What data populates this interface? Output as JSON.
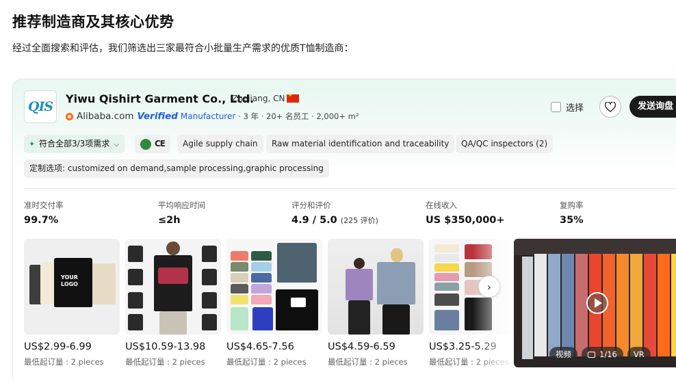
{
  "header": {
    "title": "推荐制造商及其核心优势",
    "subtitle": "经过全面搜索和评估，我们筛选出三家最符合小批量生产需求的优质T恤制造商："
  },
  "supplier": {
    "logo_text": "QIS",
    "name": "Yiwu Qishirt Garment Co., Ltd.",
    "location": "Zhejiang,  CN",
    "platform": "Alibaba.com",
    "verified": "Verified",
    "type": "Manufacturer",
    "meta": "· 3 年 · 20+ 名员工 · 2,000+ m²",
    "select_label": "选择",
    "inquiry_label": "发送询盘",
    "tags": {
      "match": "符合全部3/3项需求",
      "cert": "CE",
      "t1": "Agile supply chain",
      "t2": "Raw material identification and traceability",
      "t3": "QA/QC inspectors (2)",
      "custom": "定制选项: customized on demand,sample processing,graphic processing"
    },
    "stats": [
      {
        "label": "准时交付率",
        "value": "99.7%"
      },
      {
        "label": "平均响应时间",
        "value": "≤2h"
      },
      {
        "label": "评分和评价",
        "value": "4.9 / 5.0",
        "extra": "(225 评价)"
      },
      {
        "label": "在线收入",
        "value": "US $350,000+"
      },
      {
        "label": "复购率",
        "value": "35%"
      }
    ],
    "products": [
      {
        "price": "US$2.99-6.99",
        "moq": "最低起订量 : 2 pieces"
      },
      {
        "price": "US$10.59-13.98",
        "moq": "最低起订量 : 2 pieces"
      },
      {
        "price": "US$4.65-7.56",
        "moq": "最低起订量 : 2 pieces"
      },
      {
        "price": "US$4.59-6.59",
        "moq": "最低起订量 : 2 pieces"
      },
      {
        "price": "US$3.25-5.29",
        "moq": "最低起订量 : 2 pieces"
      }
    ],
    "video": {
      "label": "视频",
      "count": "1/16",
      "vr": "VR"
    }
  },
  "icons": {
    "favorite": "heart-icon",
    "next": "chevron-right-icon",
    "play": "play-icon",
    "gallery": "gallery-icon",
    "match": "sparkle-icon"
  }
}
